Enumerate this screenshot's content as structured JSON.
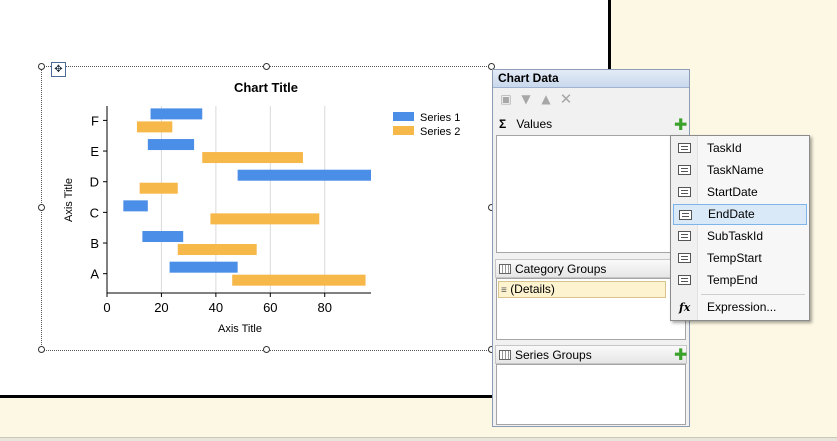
{
  "chart_data": {
    "type": "bar",
    "orientation": "horizontal",
    "title": "Chart Title",
    "xlabel": "Axis Title",
    "ylabel": "Axis Title",
    "categories": [
      "A",
      "B",
      "C",
      "D",
      "E",
      "F"
    ],
    "xlim": [
      0,
      97
    ],
    "xticks": [
      0,
      20,
      40,
      60,
      80
    ],
    "grid": true,
    "legend_position": "top-right",
    "series": [
      {
        "name": "Series 1",
        "color": "#4a8ee8",
        "ranges": [
          [
            23,
            48
          ],
          [
            13,
            28
          ],
          [
            6,
            15
          ],
          [
            48,
            97
          ],
          [
            15,
            32
          ],
          [
            16,
            35
          ]
        ]
      },
      {
        "name": "Series 2",
        "color": "#f7b84a",
        "ranges": [
          [
            46,
            95
          ],
          [
            26,
            55
          ],
          [
            38,
            78
          ],
          [
            12,
            26
          ],
          [
            35,
            72
          ],
          [
            11,
            24
          ]
        ]
      }
    ]
  },
  "panel": {
    "title": "Chart Data",
    "values_label": "Values",
    "category_groups_label": "Category Groups",
    "details_item": "(Details)",
    "series_groups_label": "Series Groups",
    "accent_color": "#3aa12a"
  },
  "menu": {
    "items": [
      {
        "label": "TaskId",
        "icon": "field-icon"
      },
      {
        "label": "TaskName",
        "icon": "field-icon"
      },
      {
        "label": "StartDate",
        "icon": "field-icon"
      },
      {
        "label": "EndDate",
        "icon": "field-icon",
        "selected": true
      },
      {
        "label": "SubTaskId",
        "icon": "field-icon"
      },
      {
        "label": "TempStart",
        "icon": "field-icon"
      },
      {
        "label": "TempEnd",
        "icon": "field-icon"
      }
    ],
    "expression_label": "Expression...",
    "expression_icon": "fx"
  }
}
